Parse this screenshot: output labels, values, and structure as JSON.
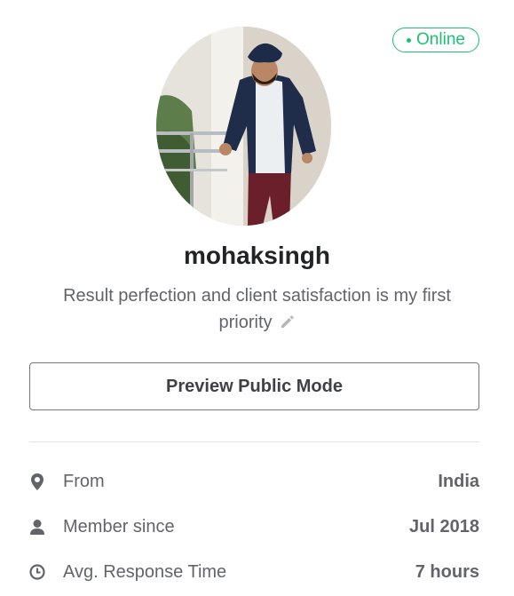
{
  "profile": {
    "status": "Online",
    "username": "mohaksingh",
    "tagline": "Result perfection and client satisfaction is my first priority",
    "avatar_icon": "profile-photo",
    "edit_icon": "pencil-icon"
  },
  "actions": {
    "preview_label": "Preview Public Mode"
  },
  "stats": [
    {
      "icon": "location-pin-icon",
      "label": "From",
      "value": "India"
    },
    {
      "icon": "user-icon",
      "label": "Member since",
      "value": "Jul 2018"
    },
    {
      "icon": "clock-icon",
      "label": "Avg. Response Time",
      "value": "7 hours"
    }
  ],
  "colors": {
    "accent": "#1dbf73",
    "text": "#404145",
    "muted": "#62646a",
    "border": "#74767e",
    "divider": "#e4e5e7"
  }
}
